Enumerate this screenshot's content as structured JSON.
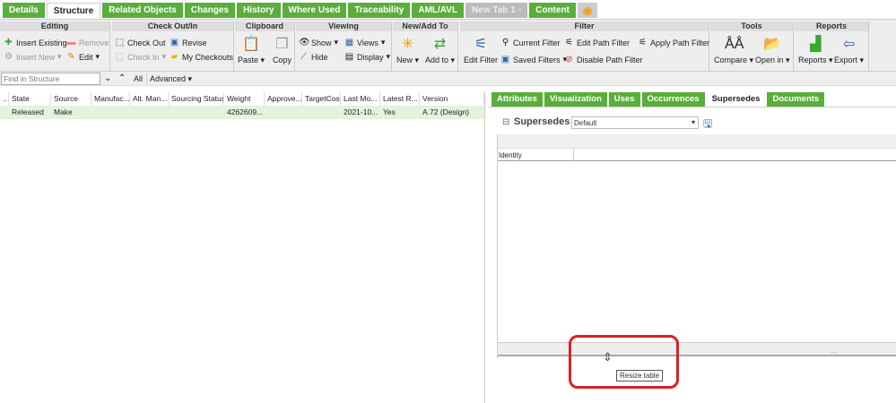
{
  "tabs": [
    {
      "label": "Details"
    },
    {
      "label": "Structure",
      "active": true
    },
    {
      "label": "Related Objects"
    },
    {
      "label": "Changes"
    },
    {
      "label": "History"
    },
    {
      "label": "Where Used"
    },
    {
      "label": "Traceability"
    },
    {
      "label": "AML/AVL"
    },
    {
      "label": "New Tab 1"
    },
    {
      "label": "Content"
    }
  ],
  "ribbon": {
    "editing": {
      "title": "Editing",
      "insert_existing": "Insert Existing",
      "remove": "Remove",
      "insert_new": "Insert New",
      "edit": "Edit"
    },
    "checkout": {
      "title": "Check Out/In",
      "check_out": "Check Out",
      "revise": "Revise",
      "check_in": "Check In",
      "my_checkouts": "My Checkouts"
    },
    "clipboard": {
      "title": "Clipboard",
      "paste": "Paste",
      "copy": "Copy"
    },
    "viewing": {
      "title": "Viewing",
      "show": "Show",
      "views": "Views",
      "hide": "Hide",
      "display": "Display"
    },
    "newadd": {
      "title": "New/Add To",
      "new": "New",
      "add_to": "Add to"
    },
    "filter": {
      "title": "Filter",
      "edit_filter": "Edit Filter",
      "current_filter": "Current Filter",
      "saved_filters": "Saved Filters",
      "edit_path_filter": "Edit Path Filter",
      "disable_path_filter": "Disable Path Filter",
      "apply_path_filter": "Apply Path Filter"
    },
    "tools": {
      "title": "Tools",
      "compare": "Compare",
      "open_in": "Open in"
    },
    "reports": {
      "title": "Reports",
      "reports": "Reports",
      "export": "Export"
    }
  },
  "search": {
    "placeholder": "Find in Structure",
    "all": "All",
    "advanced": "Advanced"
  },
  "table": {
    "columns": [
      "..",
      "State",
      "Source",
      "Manufac...",
      "Alt. Man...",
      "Sourcing Status",
      "Weight",
      "Approve...",
      "TargetCost",
      "Last Mo...",
      "Latest R...",
      "Version"
    ],
    "rows": [
      [
        "",
        "Released",
        "Make",
        "",
        "",
        "",
        "4262609...",
        "",
        "",
        "2021-10...",
        "Yes",
        "A.72 (Design)"
      ]
    ]
  },
  "right": {
    "tabs": [
      "Attributes",
      "Visualization",
      "Uses",
      "Occurrences",
      "Supersedes",
      "Documents"
    ],
    "active_tab": "Supersedes",
    "section_title": "Supersedes",
    "view_select": "Default",
    "column_identity": "Identity",
    "tooltip": "Resize table",
    "handle": "...."
  },
  "colors": {
    "accent": "#5aae3c",
    "highlight": "#e3f3dc",
    "annotation": "#d9202a"
  }
}
